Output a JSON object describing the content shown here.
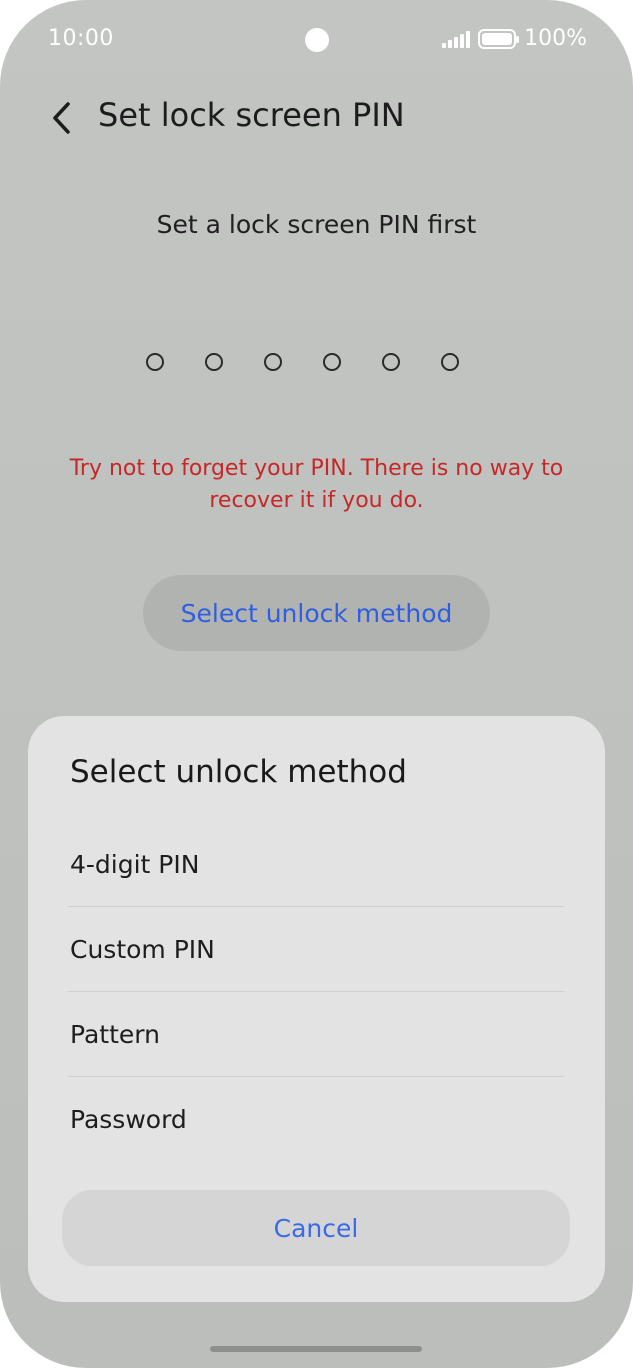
{
  "status_bar": {
    "time": "10:00",
    "battery_text": "100%",
    "icons": [
      "signal-icon",
      "battery-icon"
    ]
  },
  "header": {
    "title": "Set lock screen PIN",
    "back_icon": "chevron-left-icon"
  },
  "pin_setup": {
    "subtitle": "Set a lock screen PIN first",
    "pin_length": 6,
    "warning": "Try not to forget your PIN. There is no way to recover it if you do.",
    "select_method_label": "Select unlock method"
  },
  "sheet": {
    "title": "Select unlock method",
    "options": [
      {
        "label": "4-digit PIN"
      },
      {
        "label": "Custom PIN"
      },
      {
        "label": "Pattern"
      },
      {
        "label": "Password"
      }
    ],
    "cancel_label": "Cancel"
  },
  "colors": {
    "accent": "#2f5fe0",
    "warning": "#c62828",
    "background": "#c1c3c1",
    "sheet": "#e3e3e3"
  }
}
